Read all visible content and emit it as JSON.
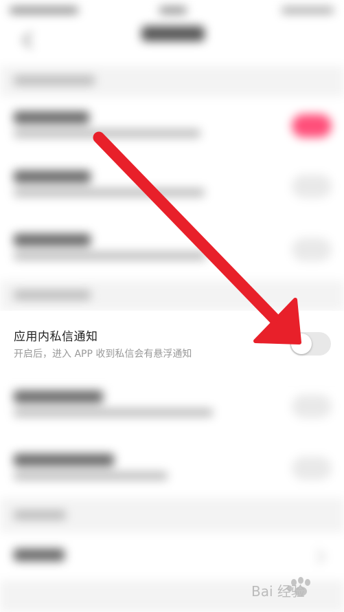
{
  "setting": {
    "title": "应用内私信通知",
    "description": "开启后，进入 APP 收到私信会有悬浮通知",
    "enabled": false
  },
  "colors": {
    "arrow": "#e8202a",
    "toggle_on": "#ff4f7a",
    "toggle_off": "#e8e8e8"
  },
  "watermark": {
    "text": "Bai 经验",
    "icon": "baidu-paw-icon"
  }
}
